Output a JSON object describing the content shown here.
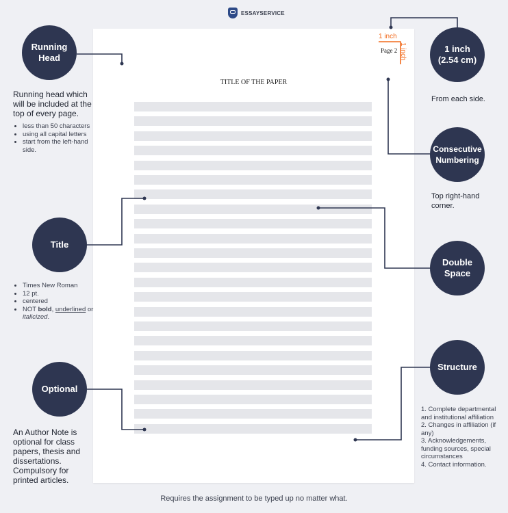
{
  "brand": {
    "name": "ESSAYSERVICE",
    "logo_icon": "shield-logo-icon"
  },
  "page": {
    "title": "TITLE OF THE PAPER",
    "page_number": "Page 2",
    "margin_top_label": "1 inch",
    "margin_right_label": "1 inch",
    "body_line_count": 23
  },
  "callouts": {
    "running_head": {
      "label": "Running Head",
      "description": "Running head which will be included at the top of every page.",
      "bullets": [
        "less than 50 characters",
        "using all capital letters",
        "start from the left-hand side."
      ]
    },
    "title": {
      "label": "Title",
      "bullets": [
        "Times New Roman",
        "12 pt.",
        "centered"
      ],
      "not_prefix": "NOT ",
      "not_bold": "bold",
      "not_sep": ", ",
      "not_underlined": "underlined",
      "not_or": " or ",
      "not_italicized": "italicized",
      "not_end": "."
    },
    "optional": {
      "label": "Optional",
      "description": "An Author Note is optional for class papers, thesis and dissertations. Compulsory for printed articles."
    },
    "one_inch": {
      "label_line1": "1 inch",
      "label_line2": "(2.54 cm)",
      "description": "From each side."
    },
    "consecutive_numbering": {
      "label_line1": "Consecutive",
      "label_line2": "Numbering",
      "description": "Top right-hand corner."
    },
    "double_space": {
      "label_line1": "Double",
      "label_line2": "Space"
    },
    "structure": {
      "label": "Structure",
      "items": [
        "1. Complete departmental and institutional affiliation",
        "2. Changes in affiliation (if any)",
        "3. Acknowledgements, funding sources, special circumstances",
        "4. Contact information."
      ]
    }
  },
  "footer": "Requires the assignment to be typed up no matter what.",
  "colors": {
    "circle": "#2e3651",
    "accent": "#f26b1d",
    "line": "#e5e6ea",
    "background": "#eff0f4"
  }
}
